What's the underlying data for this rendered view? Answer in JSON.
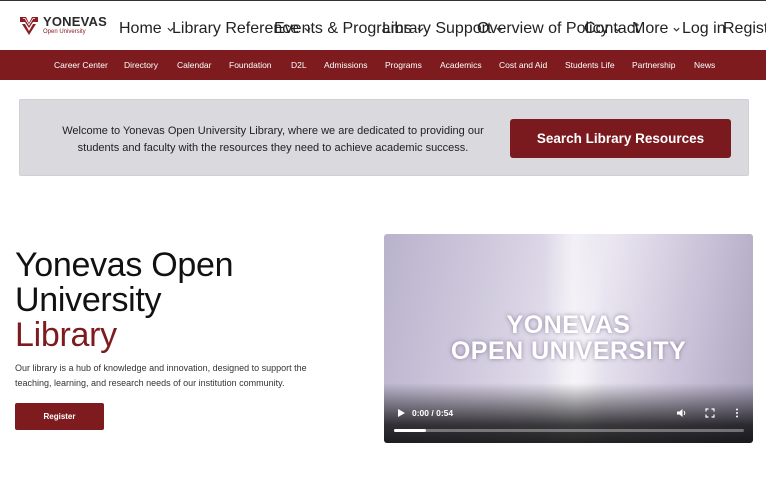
{
  "logo": {
    "name": "YONEVAS",
    "subtitle": "Open University",
    "icon": "shield-emblem-icon"
  },
  "nav": {
    "items": [
      {
        "label": "Home",
        "dropdown": true
      },
      {
        "label": "Library Reference",
        "dropdown": true
      },
      {
        "label": "Events & Programs",
        "dropdown": true
      },
      {
        "label": "Library Support",
        "dropdown": true
      },
      {
        "label": "Overview of Policy",
        "dropdown": true
      },
      {
        "label": "Contact",
        "dropdown": false
      },
      {
        "label": "More",
        "dropdown": true
      },
      {
        "label": "Log in",
        "dropdown": false
      },
      {
        "label": "Register",
        "dropdown": false
      }
    ]
  },
  "subnav": {
    "items": [
      "Career Center",
      "Directory",
      "Calendar",
      "Foundation",
      "D2L",
      "Admissions",
      "Programs",
      "Academics",
      "Cost and Aid",
      "Students Life",
      "Partnership",
      "News"
    ]
  },
  "banner": {
    "text": "Welcome to Yonevas Open University Library, where we are dedicated to providing our students and faculty with the resources they need to achieve academic success.",
    "button_label": "Search Library Resources"
  },
  "hero": {
    "title_line1": "Yonevas Open",
    "title_line2": "University",
    "title_line3": "Library",
    "description": "Our library is a hub of knowledge and innovation, designed to support the teaching, learning, and research needs of our institution community.",
    "register_label": "Register"
  },
  "video": {
    "overlay_line1": "YONEVAS",
    "overlay_line2": "OPEN UNIVERSITY",
    "time": "0:00 / 0:54",
    "progress": 0.09
  },
  "colors": {
    "brand": "#7d1b1f",
    "banner_bg": "#d9d9de"
  }
}
